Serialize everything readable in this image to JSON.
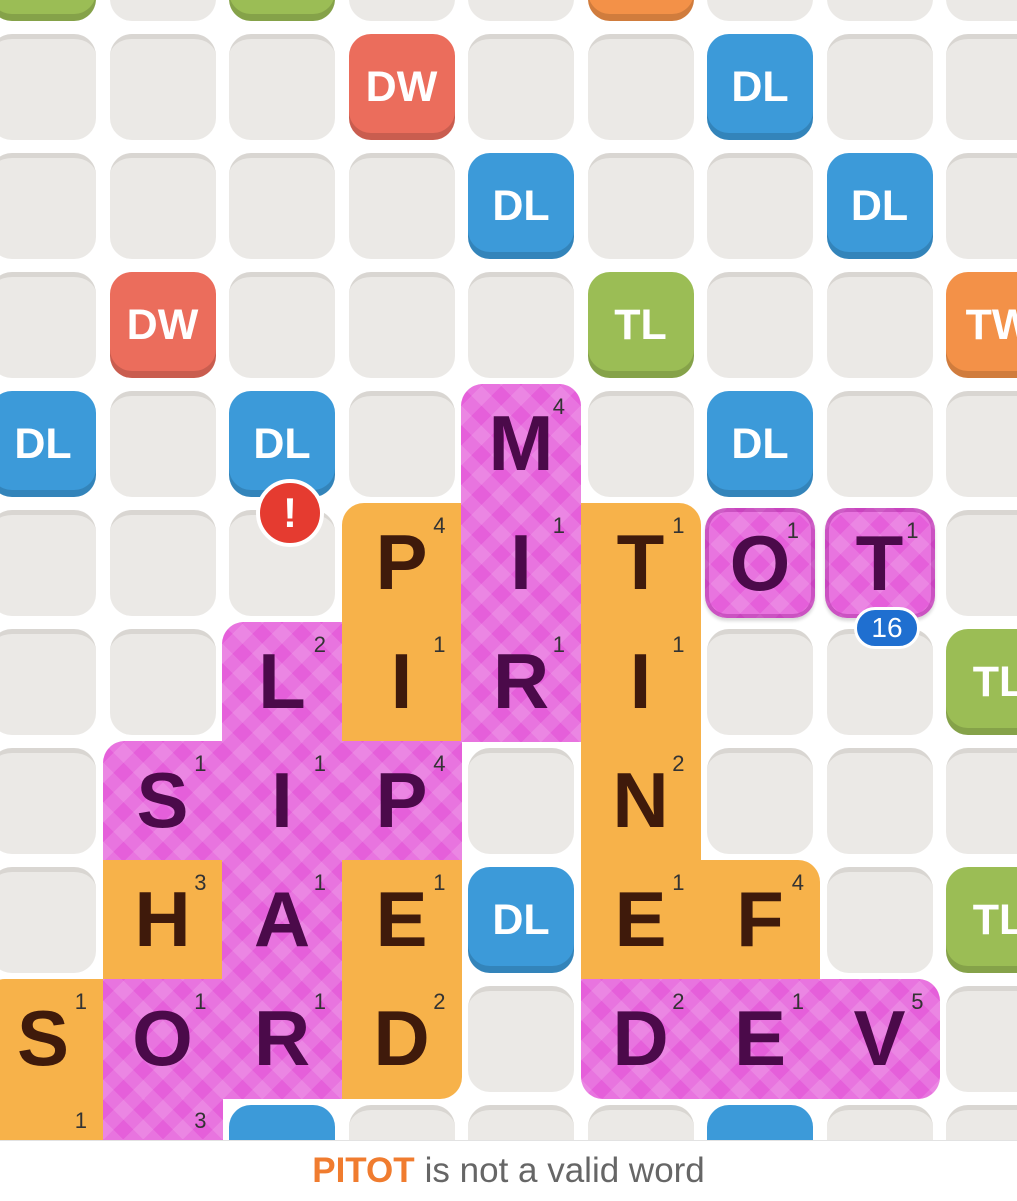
{
  "board": {
    "bonus_labels": {
      "DL": "DL",
      "TL": "TL",
      "DW": "DW",
      "TW": "TW"
    },
    "bonus_colors": {
      "DL": "#3c9ad9",
      "TL": "#9bbd55",
      "DW": "#eb6d5c",
      "TW": "#f39148"
    },
    "tile_colors": {
      "pink": "#e55fda",
      "orange": "#f7b24a"
    },
    "placed_tiles": [
      {
        "letter": "M",
        "points": "4",
        "color": "pink"
      },
      {
        "letter": "P",
        "points": "4",
        "color": "orange"
      },
      {
        "letter": "I",
        "points": "1",
        "color": "pink"
      },
      {
        "letter": "T",
        "points": "1",
        "color": "orange"
      },
      {
        "letter": "O",
        "points": "1",
        "color": "pink",
        "staged": true
      },
      {
        "letter": "T",
        "points": "1",
        "color": "pink",
        "staged": true
      },
      {
        "letter": "L",
        "points": "2",
        "color": "pink"
      },
      {
        "letter": "I",
        "points": "1",
        "color": "orange"
      },
      {
        "letter": "R",
        "points": "1",
        "color": "pink"
      },
      {
        "letter": "I",
        "points": "1",
        "color": "orange"
      },
      {
        "letter": "S",
        "points": "1",
        "color": "pink"
      },
      {
        "letter": "I",
        "points": "1",
        "color": "pink"
      },
      {
        "letter": "P",
        "points": "4",
        "color": "pink"
      },
      {
        "letter": "N",
        "points": "2",
        "color": "orange"
      },
      {
        "letter": "H",
        "points": "3",
        "color": "orange"
      },
      {
        "letter": "A",
        "points": "1",
        "color": "pink"
      },
      {
        "letter": "E",
        "points": "1",
        "color": "orange"
      },
      {
        "letter": "E",
        "points": "1",
        "color": "orange"
      },
      {
        "letter": "F",
        "points": "4",
        "color": "orange"
      },
      {
        "letter": "S",
        "points": "1",
        "color": "orange"
      },
      {
        "letter": "O",
        "points": "1",
        "color": "pink"
      },
      {
        "letter": "R",
        "points": "1",
        "color": "pink"
      },
      {
        "letter": "D",
        "points": "2",
        "color": "orange"
      },
      {
        "letter": "D",
        "points": "2",
        "color": "pink"
      },
      {
        "letter": "E",
        "points": "1",
        "color": "pink"
      },
      {
        "letter": "V",
        "points": "5",
        "color": "pink"
      },
      {
        "letter": "",
        "points": "1",
        "color": "orange"
      },
      {
        "letter": "",
        "points": "3",
        "color": "pink"
      }
    ]
  },
  "error_badge": {
    "icon": "exclamation-icon",
    "label": "!"
  },
  "score_badge": {
    "value": "16"
  },
  "status": {
    "word": "PITOT",
    "message": "is not a valid word"
  }
}
